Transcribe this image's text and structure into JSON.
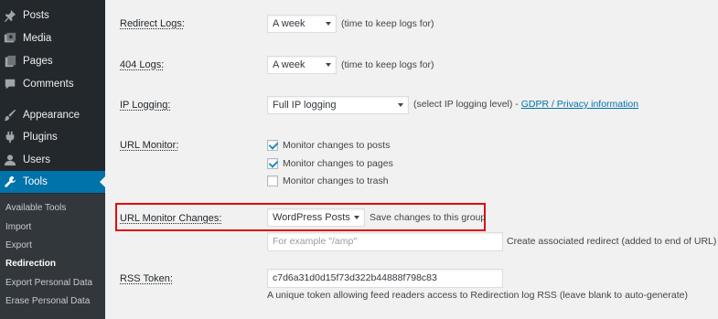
{
  "sidebar": {
    "items": [
      {
        "label": "Posts",
        "icon": "pin-icon"
      },
      {
        "label": "Media",
        "icon": "media-icon"
      },
      {
        "label": "Pages",
        "icon": "pages-icon"
      },
      {
        "label": "Comments",
        "icon": "comment-icon"
      },
      {
        "label": "Appearance",
        "icon": "brush-icon"
      },
      {
        "label": "Plugins",
        "icon": "plugin-icon"
      },
      {
        "label": "Users",
        "icon": "user-icon"
      },
      {
        "label": "Tools",
        "icon": "wrench-icon",
        "current": true
      }
    ],
    "submenu": [
      {
        "label": "Available Tools"
      },
      {
        "label": "Import"
      },
      {
        "label": "Export"
      },
      {
        "label": "Redirection",
        "active": true
      },
      {
        "label": "Export Personal Data"
      },
      {
        "label": "Erase Personal Data"
      }
    ]
  },
  "settings": {
    "redirect_logs": {
      "label": "Redirect Logs:",
      "value": "A week",
      "help": "(time to keep logs for)"
    },
    "logs_404": {
      "label": "404 Logs:",
      "value": "A week",
      "help": "(time to keep logs for)"
    },
    "ip_logging": {
      "label": "IP Logging:",
      "value": "Full IP logging",
      "help": "(select IP logging level) - ",
      "link": "GDPR / Privacy information"
    },
    "url_monitor": {
      "label": "URL Monitor:",
      "options": [
        {
          "label": "Monitor changes to posts",
          "checked": true
        },
        {
          "label": "Monitor changes to pages",
          "checked": true
        },
        {
          "label": "Monitor changes to trash",
          "checked": false
        }
      ]
    },
    "url_monitor_changes": {
      "label": "URL Monitor Changes:",
      "value": "WordPress Posts",
      "help": "Save changes to this group",
      "redirect_placeholder": "For example \"/amp\"",
      "redirect_help": "Create associated redirect (added to end of URL)"
    },
    "rss_token": {
      "label": "RSS Token:",
      "value": "c7d6a31d0d15f73d322b44888f798c83",
      "help": "A unique token allowing feed readers access to Redirection log RSS (leave blank to auto-generate)"
    }
  },
  "colors": {
    "sidebar_bg": "#23282d",
    "submenu_bg": "#32373c",
    "current_bg": "#0073aa",
    "highlight": "#e00d0d",
    "link": "#0073aa"
  }
}
